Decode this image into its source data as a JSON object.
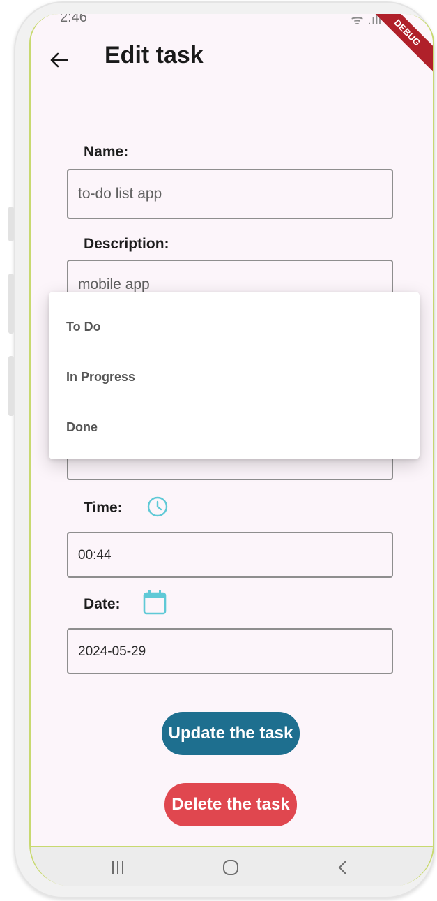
{
  "status_bar": {
    "time": "2:46",
    "right_text": "ᯤ .ıll 69"
  },
  "debug_banner": "DEBUG",
  "header": {
    "title": "Edit task"
  },
  "form": {
    "name_label": "Name:",
    "name_value": "to-do list app",
    "description_label": "Description:",
    "description_value": "mobile app",
    "status_value": "",
    "time_label": "Time:",
    "time_value": "00:44",
    "date_label": "Date:",
    "date_value": "2024-05-29"
  },
  "dropdown": {
    "options": [
      "To Do",
      "In Progress",
      "Done"
    ]
  },
  "actions": {
    "update_label": "Update the task",
    "delete_label": "Delete the task"
  },
  "colors": {
    "accent_icon": "#5fc9d6",
    "update_button": "#1e6f8f",
    "delete_button": "#e0474f",
    "background": "#fcf5fa"
  },
  "icons": {
    "back": "arrow-left",
    "time": "clock",
    "date": "calendar"
  }
}
